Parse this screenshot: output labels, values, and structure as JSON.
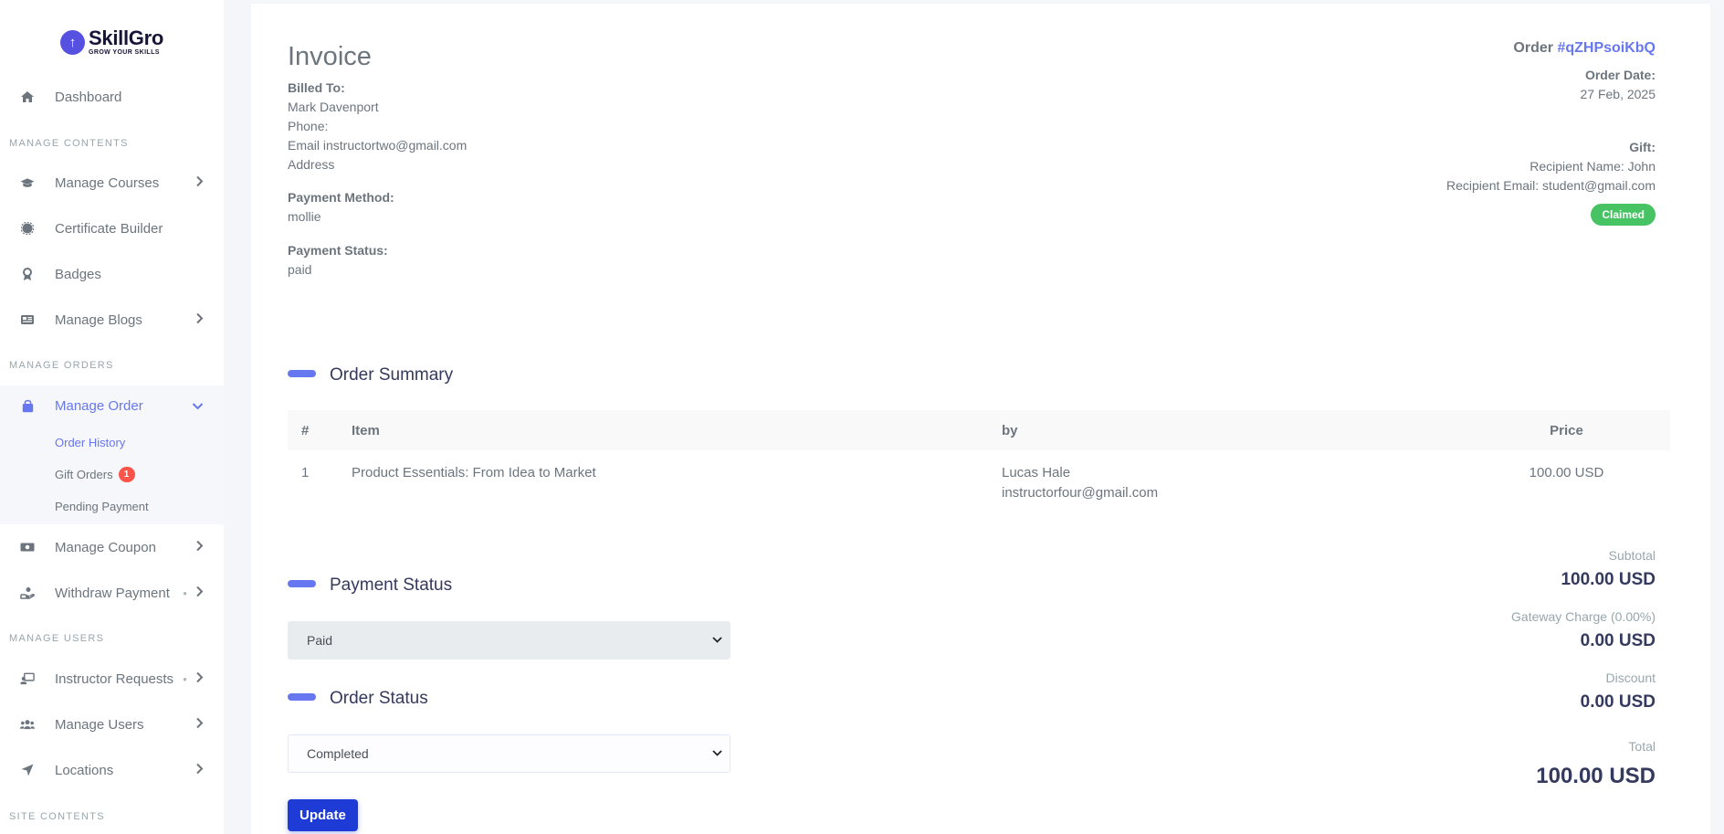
{
  "brand": {
    "name": "SkillGro",
    "tagline": "GROW YOUR SKILLS",
    "mark": "↑"
  },
  "sidebar": {
    "dashboard": "Dashboard",
    "section_contents": "MANAGE CONTENTS",
    "manage_courses": "Manage Courses",
    "certificate_builder": "Certificate Builder",
    "badges": "Badges",
    "manage_blogs": "Manage Blogs",
    "section_orders": "MANAGE ORDERS",
    "manage_order": "Manage Order",
    "order_history": "Order History",
    "gift_orders": "Gift Orders",
    "gift_orders_count": "1",
    "pending_payment": "Pending Payment",
    "manage_coupon": "Manage Coupon",
    "withdraw_payment": "Withdraw Payment",
    "section_users": "MANAGE USERS",
    "instructor_requests": "Instructor Requests",
    "manage_users": "Manage Users",
    "locations": "Locations",
    "section_site": "SITE CONTENTS"
  },
  "invoice": {
    "title": "Invoice",
    "billed_to_label": "Billed To:",
    "billed_name": "Mark Davenport",
    "phone": "Phone:",
    "email": "Email instructortwo@gmail.com",
    "address": "Address",
    "payment_method_label": "Payment Method:",
    "payment_method": "mollie",
    "payment_status_label": "Payment Status:",
    "payment_status": "paid",
    "order_prefix": "Order ",
    "order_id": "#qZHPsoiKbQ",
    "order_date_label": "Order Date:",
    "order_date": "27 Feb, 2025",
    "gift_label": "Gift:",
    "recipient_name": "Recipient Name: John",
    "recipient_email": "Recipient Email: student@gmail.com",
    "gift_status": "Claimed"
  },
  "order_summary": {
    "title": "Order Summary",
    "columns": [
      "#",
      "Item",
      "by",
      "Price"
    ],
    "rows": [
      {
        "num": "1",
        "item": "Product Essentials: From Idea to Market",
        "by_name": "Lucas Hale",
        "by_email": "instructorfour@gmail.com",
        "price": "100.00 USD"
      }
    ]
  },
  "payment_status_section": {
    "title": "Payment Status",
    "selected": "Paid"
  },
  "order_status_section": {
    "title": "Order Status",
    "selected": "Completed"
  },
  "update_button": "Update",
  "totals": {
    "subtotal_label": "Subtotal",
    "subtotal": "100.00 USD",
    "gateway_label": "Gateway Charge (0.00%)",
    "gateway": "0.00 USD",
    "discount_label": "Discount",
    "discount": "0.00 USD",
    "total_label": "Total",
    "total": "100.00 USD"
  },
  "colors": {
    "accent": "#6777ef",
    "success": "#47c363",
    "danger": "#fc544b",
    "button": "#1f3bd6"
  }
}
